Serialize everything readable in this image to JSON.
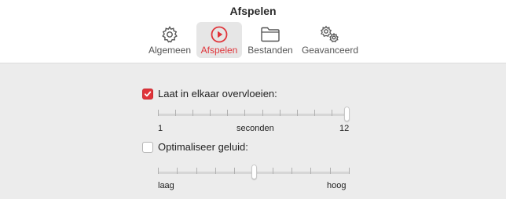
{
  "window": {
    "title": "Afspelen"
  },
  "tabs": [
    {
      "label": "Algemeen",
      "icon": "gear-icon",
      "active": false
    },
    {
      "label": "Afspelen",
      "icon": "play-circle-icon",
      "active": true
    },
    {
      "label": "Bestanden",
      "icon": "folder-icon",
      "active": false
    },
    {
      "label": "Geavanceerd",
      "icon": "gears-icon",
      "active": false
    }
  ],
  "crossfade": {
    "label": "Laat in elkaar overvloeien:",
    "checked": true,
    "slider": {
      "min_label": "1",
      "unit_label": "seconden",
      "max_label": "12",
      "min": 1,
      "max": 12,
      "value": 12
    }
  },
  "sound_enhancer": {
    "label": "Optimaliseer geluid:",
    "checked": false,
    "slider": {
      "min_label": "laag",
      "max_label": "hoog",
      "value_fraction": 0.5
    }
  },
  "colors": {
    "accent": "#e0343a",
    "background": "#ececec"
  }
}
